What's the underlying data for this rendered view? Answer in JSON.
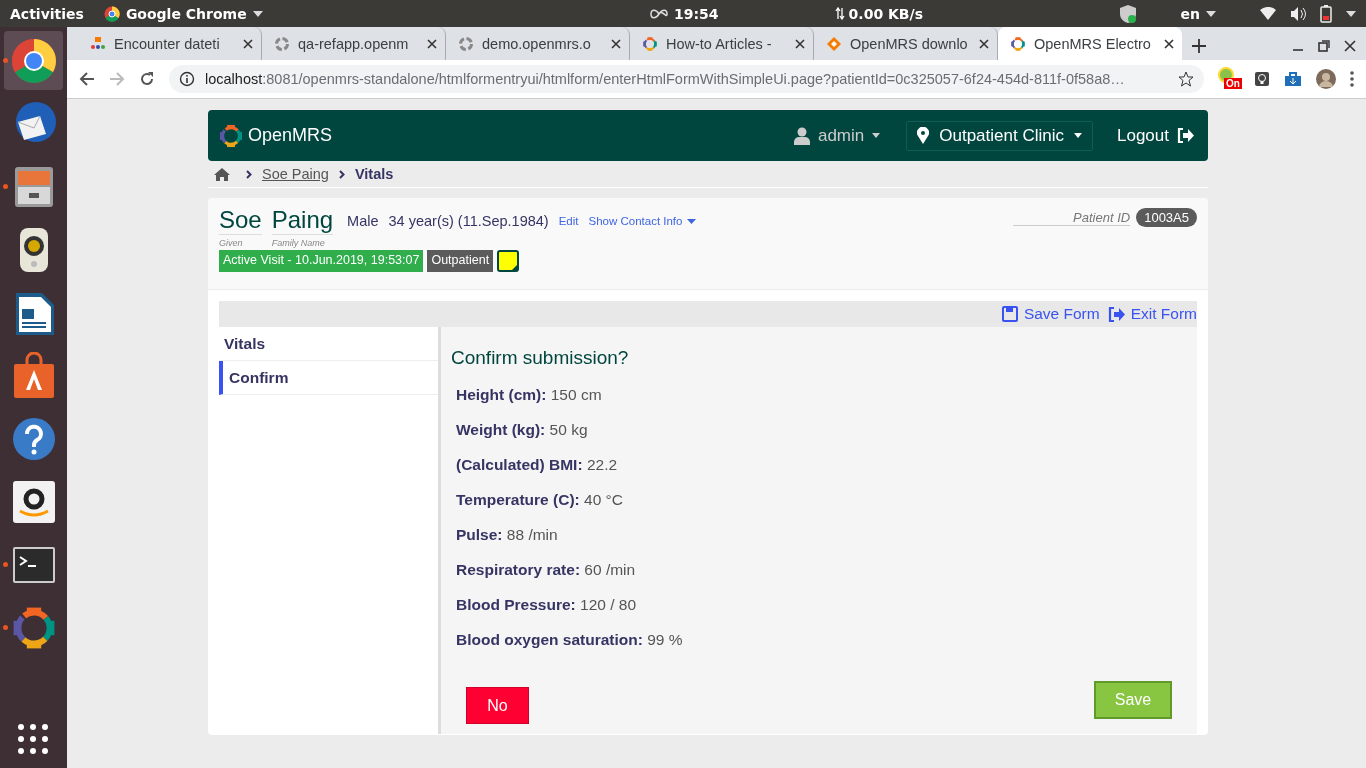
{
  "system_bar": {
    "activities": "Activities",
    "app_menu": "Google Chrome",
    "clock": "19:54",
    "net_speed": "0.00 KB/s",
    "language": "en"
  },
  "dock": [
    {
      "kind": "chrome",
      "running": true,
      "selected": true
    },
    {
      "kind": "mail",
      "running": false,
      "selected": false
    },
    {
      "kind": "files",
      "running": true,
      "selected": false
    },
    {
      "kind": "speaker",
      "running": false,
      "selected": false
    },
    {
      "kind": "writer",
      "running": false,
      "selected": false
    },
    {
      "kind": "store",
      "running": false,
      "selected": false
    },
    {
      "kind": "help",
      "running": false,
      "selected": false
    },
    {
      "kind": "amazon",
      "running": false,
      "selected": false
    },
    {
      "kind": "terminal",
      "running": true,
      "selected": false
    },
    {
      "kind": "openmrs",
      "running": true,
      "selected": false
    }
  ],
  "browser": {
    "tabs": [
      {
        "kind": "people",
        "title": "Encounter dateti",
        "selected": false
      },
      {
        "kind": "ring",
        "title": "qa-refapp.openm",
        "selected": false
      },
      {
        "kind": "ring",
        "title": "demo.openmrs.o",
        "selected": false
      },
      {
        "kind": "openmrs",
        "title": "How-to Articles -",
        "selected": false
      },
      {
        "kind": "diamond",
        "title": "OpenMRS downlo",
        "selected": false
      },
      {
        "kind": "openmrs",
        "title": "OpenMRS Electro",
        "selected": true
      }
    ],
    "address": {
      "host": "localhost",
      "path": ":8081/openmrs-standalone/htmlformentryui/htmlform/enterHtmlFormWithSimpleUi.page?patientId=0c325057-6f24-454d-811f-0f58a8…"
    },
    "extension_badge": "On"
  },
  "header": {
    "brand": "OpenMRS",
    "user": "admin",
    "location": "Outpatient Clinic",
    "logout": "Logout"
  },
  "breadcrumb": [
    "Soe Paing",
    "Vitals"
  ],
  "patient": {
    "given": "Soe",
    "family": "Paing",
    "given_label": "Given",
    "family_label": "Family Name",
    "gender": "Male",
    "age": "34 year(s) (11.Sep.1984)",
    "edit": "Edit",
    "contact": "Show Contact Info",
    "id_label": "Patient ID",
    "id": "1003A5",
    "visit": "Active Visit - 10.Jun.2019, 19:53:07",
    "visit_type": "Outpatient"
  },
  "form": {
    "actions": [
      "Save Form",
      "Exit Form"
    ],
    "sections": [
      {
        "label": "Vitals",
        "selected": false
      },
      {
        "label": "Confirm",
        "selected": true
      }
    ],
    "title": "Confirm submission?",
    "fields": [
      {
        "label": "Height (cm):",
        "value": "150 cm"
      },
      {
        "label": "Weight (kg):",
        "value": "50 kg"
      },
      {
        "label": "(Calculated) BMI:",
        "value": "22.2"
      },
      {
        "label": "Temperature (C):",
        "value": "40 °C"
      },
      {
        "label": "Pulse:",
        "value": "88 /min"
      },
      {
        "label": "Respiratory rate:",
        "value": "60 /min"
      },
      {
        "label": "Blood Pressure:",
        "value": "120 / 80"
      },
      {
        "label": "Blood oxygen saturation:",
        "value": "99 %"
      }
    ],
    "no": "No",
    "save": "Save"
  }
}
